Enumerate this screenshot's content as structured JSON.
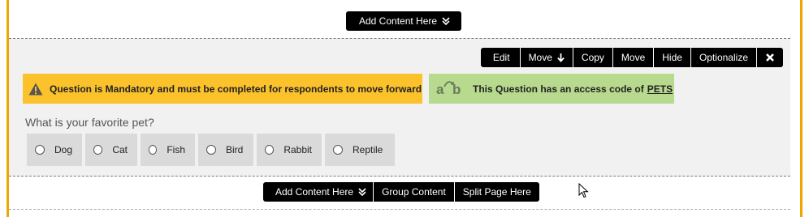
{
  "top_bar": {
    "add_content": "Add Content Here"
  },
  "toolbar": {
    "edit": "Edit",
    "move_down": "Move",
    "copy": "Copy",
    "move": "Move",
    "hide": "Hide",
    "optionalize": "Optionalize"
  },
  "alerts": {
    "mandatory": "Question is Mandatory and must be completed for respondents to move forward",
    "access_text": "This Question has an access code of",
    "access_code": "PETS",
    "access_icon_a": "a",
    "access_icon_b": "b"
  },
  "question": {
    "text": "What is your favorite pet?",
    "choices": [
      "Dog",
      "Cat",
      "Fish",
      "Bird",
      "Rabbit",
      "Reptile"
    ]
  },
  "bottom_bar": {
    "add_content": "Add Content Here",
    "group_content": "Group Content",
    "split_page": "Split Page Here"
  },
  "colors": {
    "accent_border": "#f0a500",
    "mandatory_bg": "#fcc22c",
    "access_bg": "#b8da8e"
  }
}
